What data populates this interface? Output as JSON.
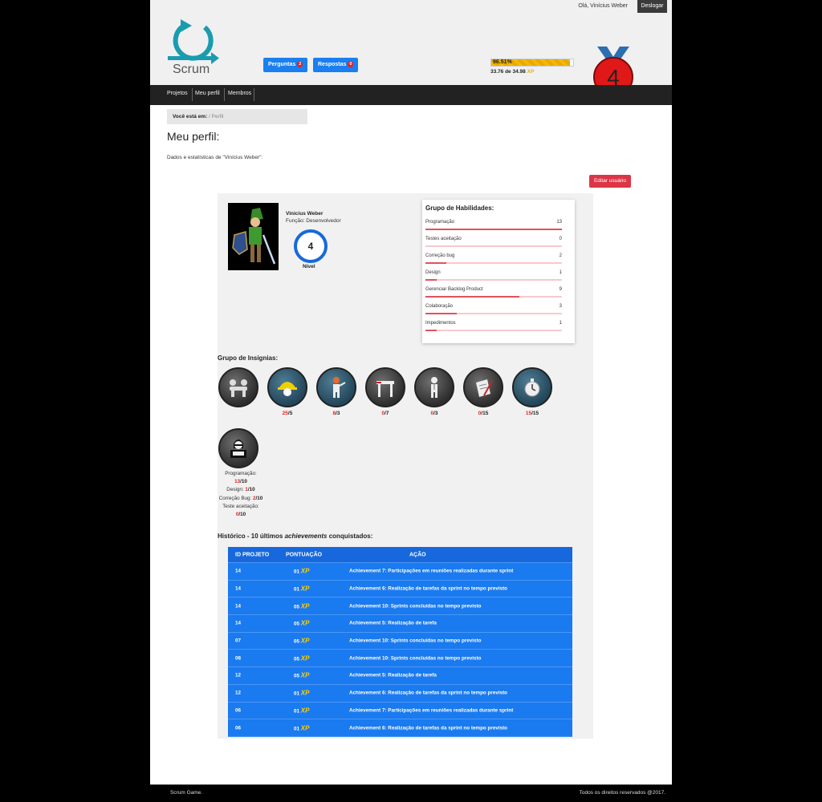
{
  "header": {
    "greeting": "Olá, Vinícius Weber",
    "logout_label": "Deslogar",
    "logo_text": "Scrum",
    "questions": {
      "label": "Perguntas",
      "count": "2"
    },
    "answers": {
      "label": "Respostas",
      "count": "0"
    },
    "xp": {
      "percent_label": "96.51%",
      "percent": 96.51,
      "current": "33.76 de 34.98",
      "unit": "XP"
    },
    "medal_level": "4"
  },
  "nav": {
    "items": [
      "Projetos",
      "Meu perfil",
      "Membros"
    ]
  },
  "breadcrumb": {
    "prefix": "Você está em:",
    "separator": "/",
    "current": "Perfil"
  },
  "page": {
    "title": "Meu perfil:",
    "subtitle": "Dados e estatísticas de \"Vinícius Weber\":",
    "edit_button": "Editar usuário"
  },
  "profile": {
    "name": "Vinicius Weber",
    "role": "Função: Desenvolvedor",
    "level": "4",
    "level_label": "Nível"
  },
  "skills": {
    "title": "Grupo de Habilidades:",
    "items": [
      {
        "label": "Programação",
        "value": "13",
        "fill": 1.0
      },
      {
        "label": "Testes aceitação",
        "value": "0",
        "fill": 0.0
      },
      {
        "label": "Correção bug",
        "value": "2",
        "fill": 0.15
      },
      {
        "label": "Design",
        "value": "1",
        "fill": 0.08
      },
      {
        "label": "Gerenciar Backlog Product",
        "value": "9",
        "fill": 0.69
      },
      {
        "label": "Colaboração",
        "value": "3",
        "fill": 0.23
      },
      {
        "label": "Impedimentos",
        "value": "1",
        "fill": 0.08
      }
    ]
  },
  "badges": {
    "title": "Grupo de Insignias:",
    "items": [
      {
        "icon": "handshake-icon",
        "got": "",
        "total": ""
      },
      {
        "icon": "hardhat-icon",
        "got": "25",
        "total": "/5"
      },
      {
        "icon": "presenter-icon",
        "got": "8",
        "total": "/3"
      },
      {
        "icon": "hurdle-icon",
        "got": "0",
        "total": "/7"
      },
      {
        "icon": "businessman-icon",
        "got": "0",
        "total": "/3"
      },
      {
        "icon": "contract-icon",
        "got": "0",
        "total": "/15"
      },
      {
        "icon": "stopwatch-icon",
        "got": "15",
        "total": "/15"
      }
    ],
    "big": {
      "icon": "coder-icon",
      "lines": [
        {
          "label": "Programação:",
          "got": "13",
          "total": "/10"
        },
        {
          "label": "Design:",
          "got": "1",
          "total": "/10"
        },
        {
          "label": "Correção Bug:",
          "got": "2",
          "total": "/10"
        },
        {
          "label": "Teste aceitação:",
          "got": "0",
          "total": "/10"
        }
      ]
    }
  },
  "history": {
    "title_start": "Histórico - 10 últimos ",
    "title_em": "achievements",
    "title_end": " conquistados:",
    "headers": [
      "ID PROJETO",
      "PONTUAÇÃO",
      "AÇÃO"
    ],
    "rows": [
      {
        "id": "14",
        "points": "01",
        "action": "Achievement 7: Participações em reuniões realizadas durante sprint"
      },
      {
        "id": "14",
        "points": "01",
        "action": "Achievement 6: Realização de tarefas da sprint no tempo previsto"
      },
      {
        "id": "14",
        "points": "05",
        "action": "Achievement 10: Sprints concluídas no tempo previsto"
      },
      {
        "id": "14",
        "points": "05",
        "action": "Achievement 5: Realização de tarefa"
      },
      {
        "id": "07",
        "points": "05",
        "action": "Achievement 10: Sprints concluídas no tempo previsto"
      },
      {
        "id": "08",
        "points": "05",
        "action": "Achievement 10: Sprints concluídas no tempo previsto"
      },
      {
        "id": "12",
        "points": "05",
        "action": "Achievement 5: Realização de tarefa"
      },
      {
        "id": "12",
        "points": "01",
        "action": "Achievement 6: Realização de tarefas da sprint no tempo previsto"
      },
      {
        "id": "06",
        "points": "01",
        "action": "Achievement 7: Participações em reuniões realizadas durante sprint"
      },
      {
        "id": "06",
        "points": "01",
        "action": "Achievement 6: Realização de tarefas da sprint no tempo previsto"
      }
    ],
    "xp_unit": "XP"
  },
  "footer": {
    "left": "Scrum Game.",
    "right": "Todos os direitos reservados @2017."
  },
  "colors": {
    "primary": "#1a7af0",
    "danger": "#dc3545",
    "gold": "#f3b800",
    "nav": "#222222"
  }
}
